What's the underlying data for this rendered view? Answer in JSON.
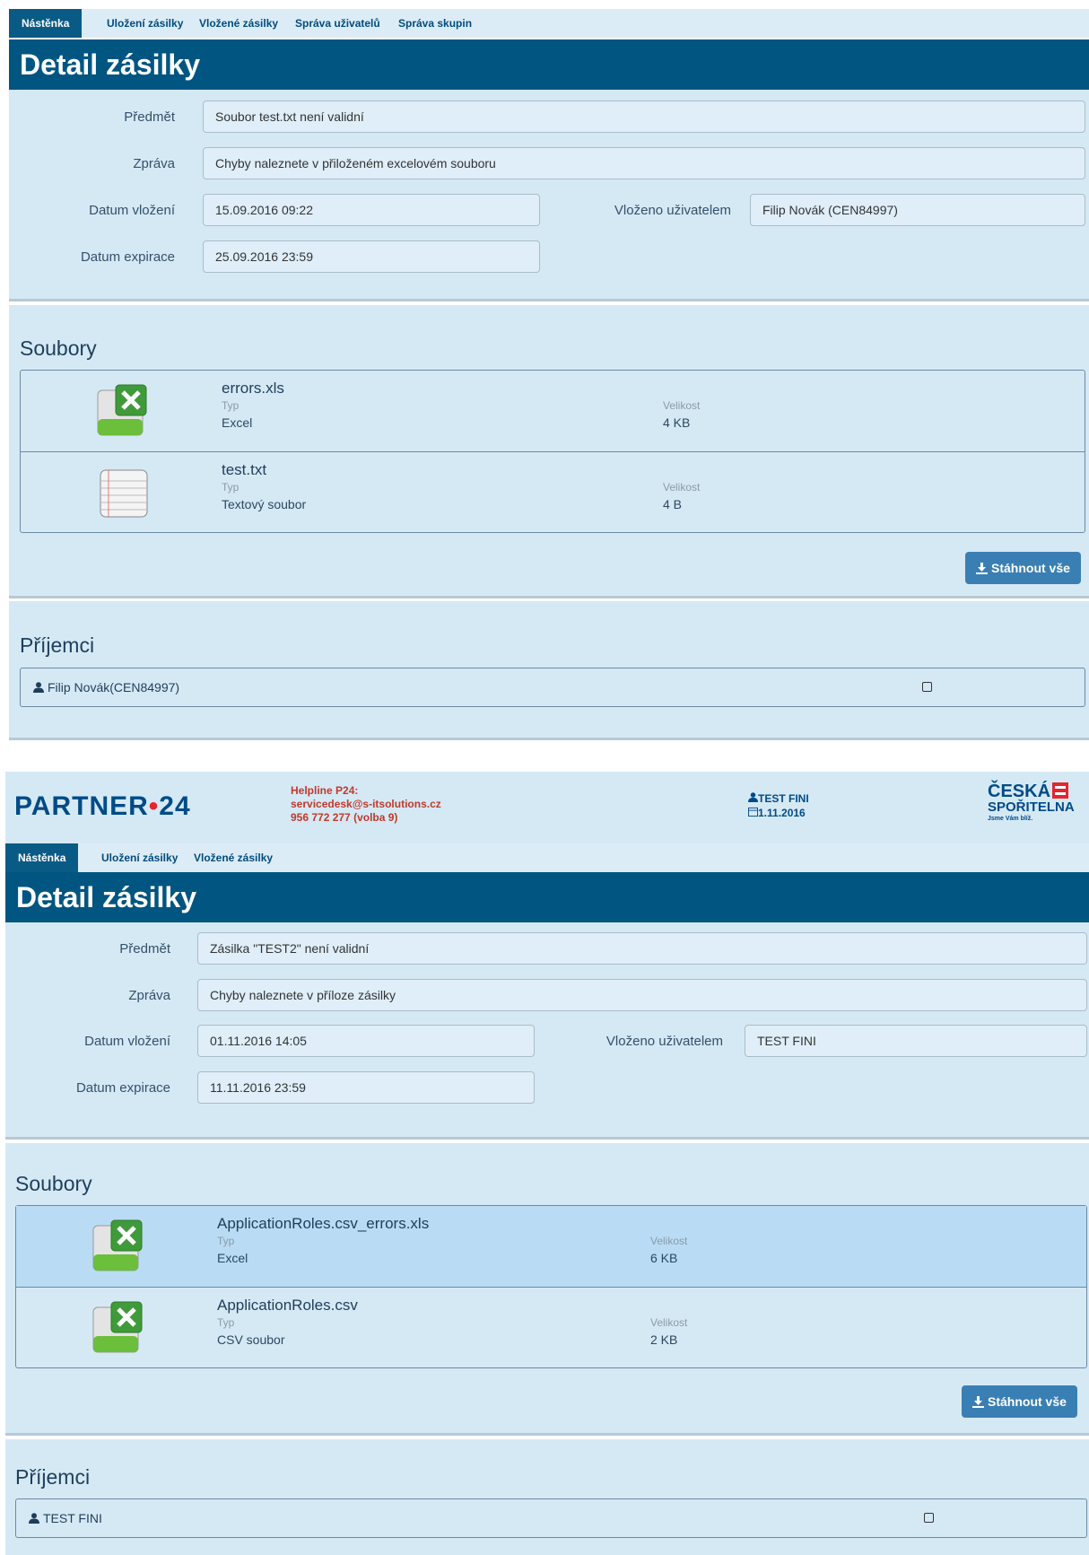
{
  "screen1": {
    "nav": [
      "Nástěnka",
      "Uložení zásilky",
      "Vložené zásilky",
      "Správa uživatelů",
      "Správa skupin"
    ],
    "title": "Detail zásilky",
    "form": {
      "subject_label": "Předmět",
      "subject_value": "Soubor test.txt není validní",
      "message_label": "Zpráva",
      "message_value": "Chyby naleznete v přiloženém excelovém souboru",
      "inserted_label": "Datum vložení",
      "inserted_value": "15.09.2016 09:22",
      "user_label": "Vloženo uživatelem",
      "user_value": "Filip Novák (CEN84997)",
      "expiry_label": "Datum expirace",
      "expiry_value": "25.09.2016 23:59"
    },
    "files_title": "Soubory",
    "files": [
      {
        "name": "errors.xls",
        "type_label": "Typ",
        "type": "Excel",
        "size_label": "Velikost",
        "size": "4 KB",
        "icon": "excel-icon"
      },
      {
        "name": "test.txt",
        "type_label": "Typ",
        "type": "Textový soubor",
        "size_label": "Velikost",
        "size": "4 B",
        "icon": "text-file-icon"
      }
    ],
    "download_all": "Stáhnout vše",
    "recipients_title": "Příjemci",
    "recipients": [
      {
        "name": "Filip Novák(CEN84997)"
      }
    ]
  },
  "screen2": {
    "header": {
      "logo_left": "PARTNER",
      "logo_dot": "•",
      "logo_right": "24",
      "helpline": "Helpline P24:",
      "email": "servicedesk@s-itsolutions.cz",
      "phone": "956 772 277 (volba 9)",
      "user": "TEST FINI",
      "date": "1.11.2016",
      "bank_line1": "ČESKÁ",
      "bank_line2": "SPOŘITELNA",
      "bank_slogan": "Jsme Vám blíž."
    },
    "nav": [
      "Nástěnka",
      "Uložení zásilky",
      "Vložené zásilky"
    ],
    "title": "Detail zásilky",
    "form": {
      "subject_label": "Předmět",
      "subject_value": "Zásilka \"TEST2\" není validní",
      "message_label": "Zpráva",
      "message_value": "Chyby naleznete v příloze zásilky",
      "inserted_label": "Datum vložení",
      "inserted_value": "01.11.2016 14:05",
      "user_label": "Vloženo uživatelem",
      "user_value": "TEST FINI",
      "expiry_label": "Datum expirace",
      "expiry_value": "11.11.2016 23:59"
    },
    "files_title": "Soubory",
    "files": [
      {
        "name": "ApplicationRoles.csv_errors.xls",
        "type_label": "Typ",
        "type": "Excel",
        "size_label": "Velikost",
        "size": "6 KB",
        "icon": "excel-icon"
      },
      {
        "name": "ApplicationRoles.csv",
        "type_label": "Typ",
        "type": "CSV soubor",
        "size_label": "Velikost",
        "size": "2 KB",
        "icon": "excel-icon"
      }
    ],
    "download_all": "Stáhnout vše",
    "recipients_title": "Příjemci",
    "recipients": [
      {
        "name": "TEST FINI"
      }
    ]
  },
  "colors": {
    "title_bar": "#005581",
    "panel": "#d5e9f5",
    "button": "#3a7fb4",
    "helpline": "#c0392b"
  }
}
